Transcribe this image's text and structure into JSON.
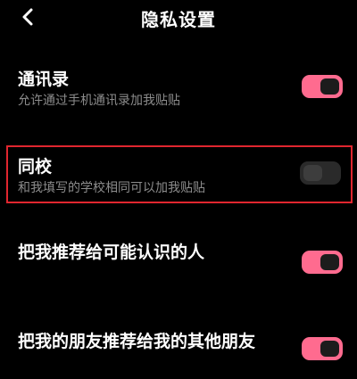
{
  "header": {
    "title": "隐私设置",
    "back_icon": "chevron-left-icon"
  },
  "settings": [
    {
      "label": "通讯录",
      "description": "允许通过手机通讯录加我贴贴",
      "enabled": true
    },
    {
      "label": "同校",
      "description": "和我填写的学校相同可以加我贴贴",
      "enabled": false,
      "highlighted": true
    },
    {
      "label": "把我推荐给可能认识的人",
      "description": "",
      "enabled": true
    },
    {
      "label": "把我的朋友推荐给我的其他朋友",
      "description": "",
      "enabled": true
    }
  ],
  "colors": {
    "background": "#000000",
    "toggle_on": "#ff6b8f",
    "toggle_off": "#2a2a2a",
    "highlight_border": "#e0262f",
    "description_text": "#8c8c8c"
  }
}
